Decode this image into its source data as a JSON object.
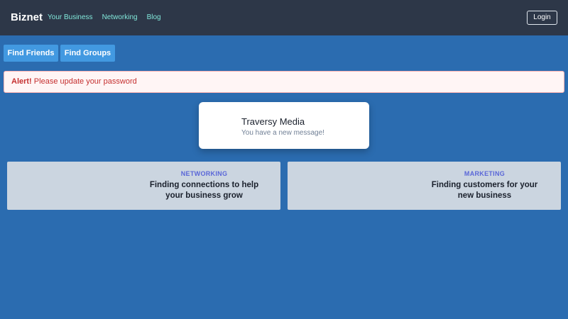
{
  "nav": {
    "brand": "Biznet",
    "links": [
      "Your Business",
      "Networking",
      "Blog"
    ],
    "login_label": "Login"
  },
  "actions": {
    "find_friends": "Find Friends",
    "find_groups": "Find Groups"
  },
  "alert": {
    "label": "Alert!",
    "message": "Please update your password"
  },
  "message_card": {
    "sender": "Traversy Media",
    "text": "You have a new message!"
  },
  "features": [
    {
      "tag": "NETWORKING",
      "text": "Finding connections to help your business grow"
    },
    {
      "tag": "MARKETING",
      "text": "Finding customers for your new business"
    }
  ],
  "colors": {
    "background": "#2b6cb0",
    "navbar": "#2d3748",
    "nav_link": "#81e6d9",
    "button": "#4299e1",
    "alert_text": "#c53030",
    "feature_bg": "#cbd5e0",
    "feature_tag": "#5a67d8"
  }
}
